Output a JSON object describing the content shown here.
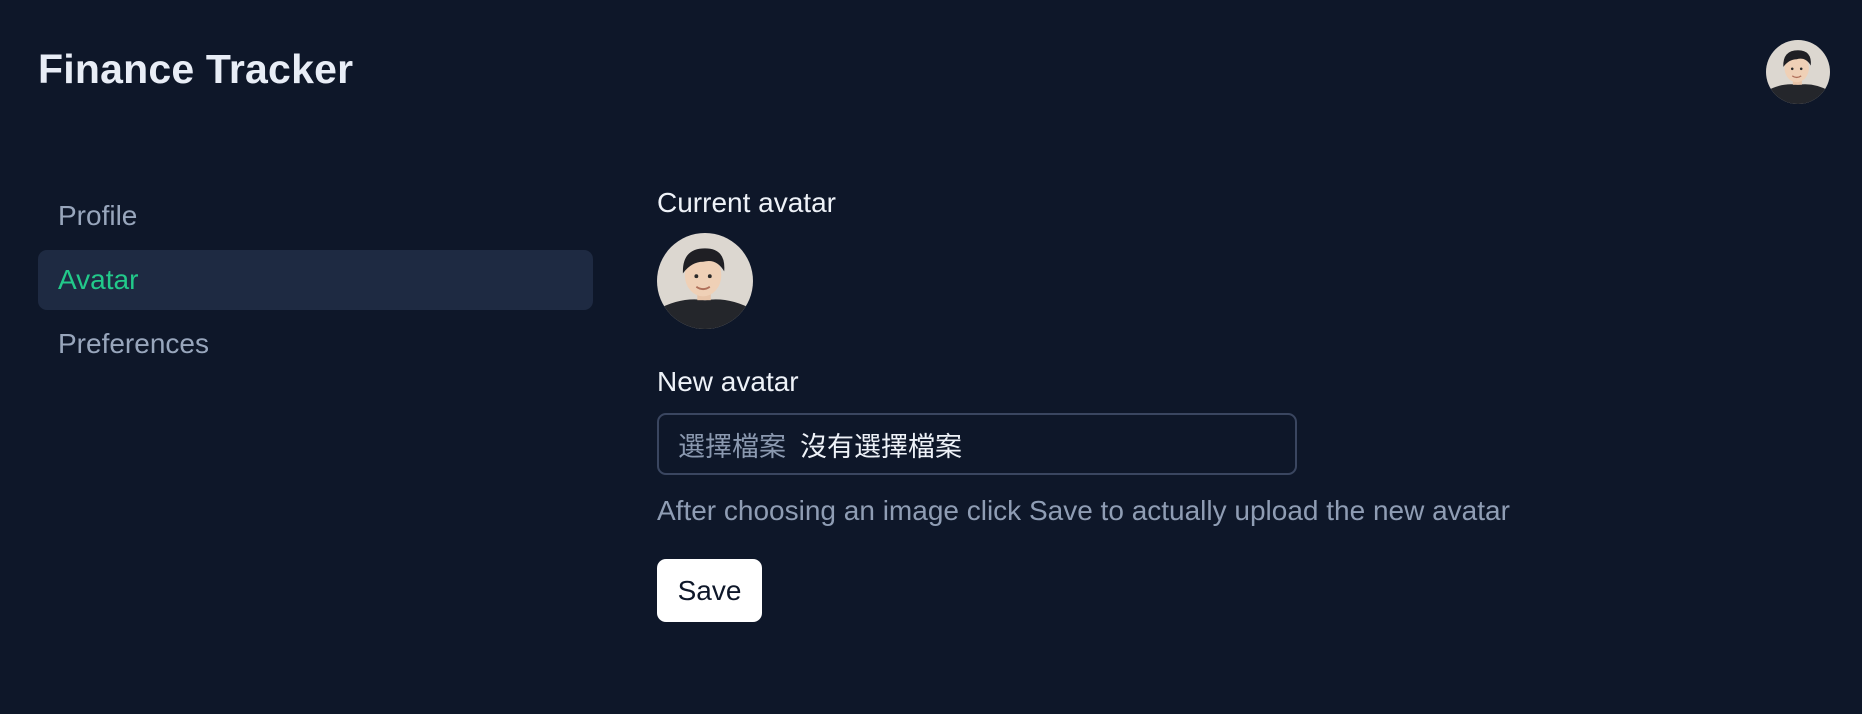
{
  "app": {
    "title": "Finance Tracker"
  },
  "header": {
    "avatar_icon": "user-avatar-photo"
  },
  "sidebar": {
    "items": [
      {
        "label": "Profile",
        "active": false
      },
      {
        "label": "Avatar",
        "active": true
      },
      {
        "label": "Preferences",
        "active": false
      }
    ]
  },
  "main": {
    "current_avatar_label": "Current avatar",
    "new_avatar_label": "New avatar",
    "file_input": {
      "button_label": "選擇檔案",
      "status_text": "沒有選擇檔案"
    },
    "help_text": "After choosing an image click Save to actually upload the new avatar",
    "save_label": "Save"
  },
  "colors": {
    "background": "#0e1729",
    "accent": "#22c98a",
    "sidebar_active_bg": "#1e2a42",
    "muted_text": "#98a6bc"
  }
}
